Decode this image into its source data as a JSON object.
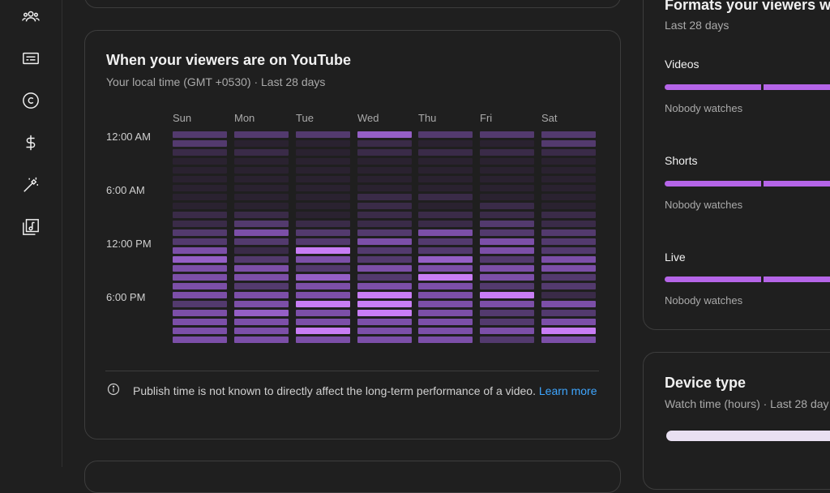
{
  "sidebar": {
    "icons": [
      "audience-icon",
      "subtitles-icon",
      "copyright-icon",
      "earn-icon",
      "customization-icon",
      "audio-library-icon"
    ]
  },
  "viewers_card": {
    "title": "When your viewers are on YouTube",
    "subtitle": "Your local time (GMT +0530) · Last 28 days",
    "days": [
      "Sun",
      "Mon",
      "Tue",
      "Wed",
      "Thu",
      "Fri",
      "Sat"
    ],
    "time_labels": [
      "12:00 AM",
      "6:00 AM",
      "12:00 PM",
      "6:00 PM"
    ],
    "note_text": "Publish time is not known to directly affect the long-term performance of a video.",
    "note_link": "Learn more"
  },
  "heatmap": {
    "levels": [
      [
        3,
        3,
        2,
        1,
        1,
        1,
        1,
        1,
        1,
        2,
        2,
        3,
        3,
        4,
        5,
        4,
        4,
        4,
        4,
        3,
        4,
        4,
        4,
        4
      ],
      [
        3,
        1,
        2,
        1,
        1,
        1,
        1,
        1,
        1,
        2,
        3,
        4,
        3,
        2,
        3,
        4,
        4,
        3,
        4,
        4,
        5,
        4,
        4,
        4
      ],
      [
        3,
        1,
        1,
        1,
        1,
        1,
        1,
        1,
        1,
        1,
        2,
        3,
        3,
        6,
        4,
        3,
        5,
        4,
        4,
        6,
        4,
        4,
        6,
        4
      ],
      [
        5,
        2,
        2,
        1,
        1,
        1,
        1,
        2,
        2,
        2,
        2,
        3,
        4,
        3,
        3,
        4,
        3,
        4,
        6,
        6,
        6,
        4,
        4,
        4
      ],
      [
        3,
        1,
        2,
        1,
        1,
        1,
        1,
        2,
        1,
        2,
        2,
        4,
        3,
        3,
        5,
        4,
        6,
        4,
        4,
        4,
        4,
        4,
        4,
        4
      ],
      [
        3,
        1,
        2,
        1,
        1,
        1,
        1,
        1,
        2,
        2,
        3,
        3,
        4,
        4,
        3,
        4,
        4,
        3,
        6,
        4,
        3,
        3,
        4,
        3
      ],
      [
        3,
        3,
        2,
        1,
        1,
        1,
        1,
        1,
        1,
        2,
        2,
        3,
        3,
        3,
        4,
        4,
        3,
        3,
        2,
        4,
        3,
        4,
        6,
        4
      ]
    ],
    "colors": [
      "#1f1f1f",
      "#2a2230",
      "#3a2b48",
      "#533a6e",
      "#7c4fa8",
      "#955fc6",
      "#c87df5"
    ]
  },
  "formats_card": {
    "title": "Formats your viewers w",
    "subtitle": "Last 28 days",
    "formats": [
      {
        "label": "Videos",
        "note": "Nobody watches"
      },
      {
        "label": "Shorts",
        "note": "Nobody watches"
      },
      {
        "label": "Live",
        "note": "Nobody watches"
      }
    ]
  },
  "device_card": {
    "title": "Device type",
    "subtitle": "Watch time (hours) · Last 28 day"
  }
}
